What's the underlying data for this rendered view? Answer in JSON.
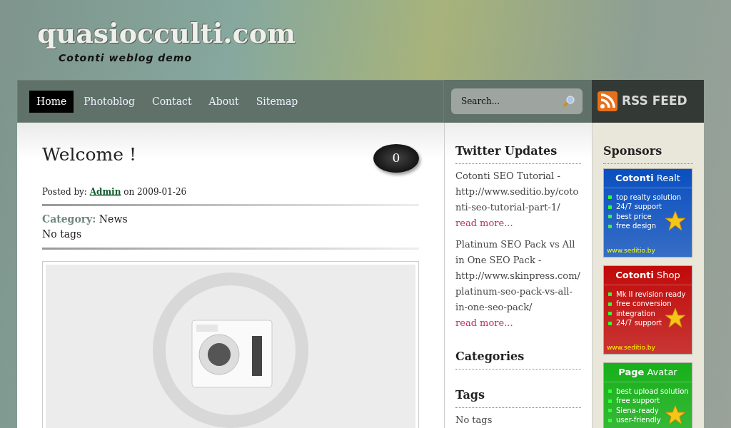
{
  "site": {
    "logo": "quasiocculti.com",
    "tagline": "Cotonti weblog demo"
  },
  "nav": [
    {
      "label": "Home",
      "selected": true
    },
    {
      "label": "Photoblog",
      "selected": false
    },
    {
      "label": "Contact",
      "selected": false
    },
    {
      "label": "About",
      "selected": false
    },
    {
      "label": "Sitemap",
      "selected": false
    }
  ],
  "search": {
    "placeholder": "Search..."
  },
  "rss": {
    "label": "RSS FEED"
  },
  "post": {
    "title": "Welcome !",
    "comments": "0",
    "posted_label": "Posted by:",
    "author": "Admin",
    "date_prefix": "on",
    "date": "2009-01-26",
    "category_label": "Category:",
    "category": "News",
    "tags": "No tags"
  },
  "twitter": {
    "title": "Twitter Updates",
    "items": [
      {
        "text": "Cotonti SEO Tutorial - http://www.seditio.by/cotonti-seo-tutorial-part-1/",
        "link": "read more..."
      },
      {
        "text": "Platinum SEO Pack vs All in One SEO Pack - http://www.skinpress.com/platinum-seo-pack-vs-all-in-one-seo-pack/",
        "link": "read more..."
      }
    ]
  },
  "categories": {
    "title": "Categories"
  },
  "tags": {
    "title": "Tags",
    "text": "No tags"
  },
  "sponsors": {
    "title": "Sponsors",
    "banners": [
      {
        "title": "**Cotonti** Realt",
        "color": "#0a4fc0",
        "bullets": [
          "top realty solution",
          "24/7 support",
          "best price",
          "free design"
        ],
        "url": "www.seditio.by"
      },
      {
        "title": "**Cotonti** Shop",
        "color": "#c00a0a",
        "bullets": [
          "Mk II revision ready",
          "free conversion",
          "integration",
          "24/7 support"
        ],
        "url": "www.seditio.by"
      },
      {
        "title": "**Page** Avatar",
        "color": "#17b01a",
        "bullets": [
          "best upload solution",
          "free support",
          "Siena-ready",
          "user-friendly"
        ]
      }
    ]
  }
}
